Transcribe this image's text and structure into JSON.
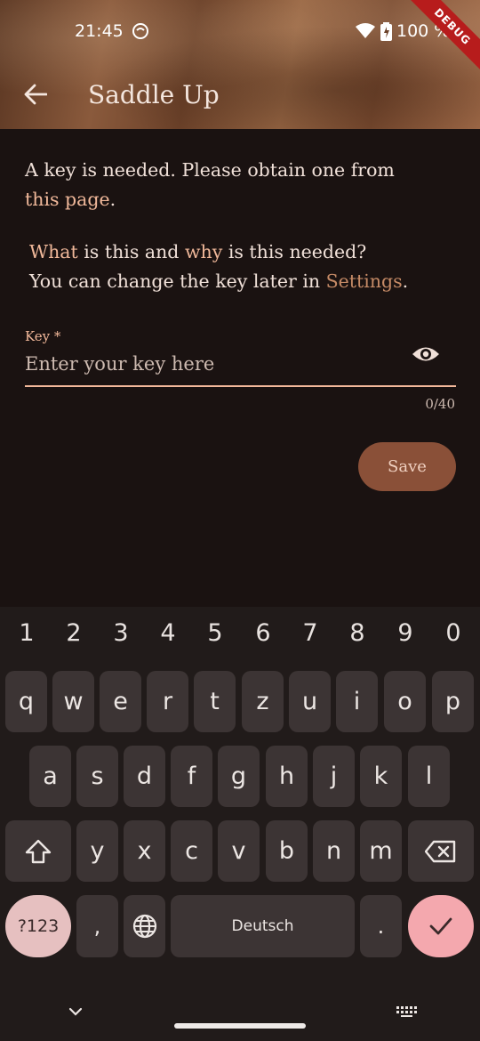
{
  "status_bar": {
    "time": "21:45",
    "battery": "100 %"
  },
  "debug_banner": "DEBUG",
  "app_bar": {
    "title": "Saddle Up"
  },
  "content": {
    "para1_prefix": "A key is needed. Please obtain one from",
    "para1_link": "this page",
    "para1_suffix": ".",
    "para2_link_what": "What",
    "para2_mid": " is this and ",
    "para2_link_why": "why",
    "para2_end": " is this needed?",
    "para3_prefix": "You can change the key later in ",
    "para3_link": "Settings",
    "para3_suffix": "."
  },
  "key_field": {
    "label": "Key *",
    "placeholder": "Enter your key here",
    "value": "",
    "counter": "0/40"
  },
  "save_label": "Save",
  "keyboard": {
    "numbers": [
      "1",
      "2",
      "3",
      "4",
      "5",
      "6",
      "7",
      "8",
      "9",
      "0"
    ],
    "row1": [
      "q",
      "w",
      "e",
      "r",
      "t",
      "z",
      "u",
      "i",
      "o",
      "p"
    ],
    "row2": [
      "a",
      "s",
      "d",
      "f",
      "g",
      "h",
      "j",
      "k",
      "l"
    ],
    "row3": [
      "y",
      "x",
      "c",
      "v",
      "b",
      "n",
      "m"
    ],
    "symbols_label": "?123",
    "comma": ",",
    "space_label": "Deutsch",
    "period": "."
  },
  "colors": {
    "accent": "#f2b89a",
    "link": "#c58a66",
    "save_bg": "#8a5038",
    "background": "#1a1211"
  }
}
